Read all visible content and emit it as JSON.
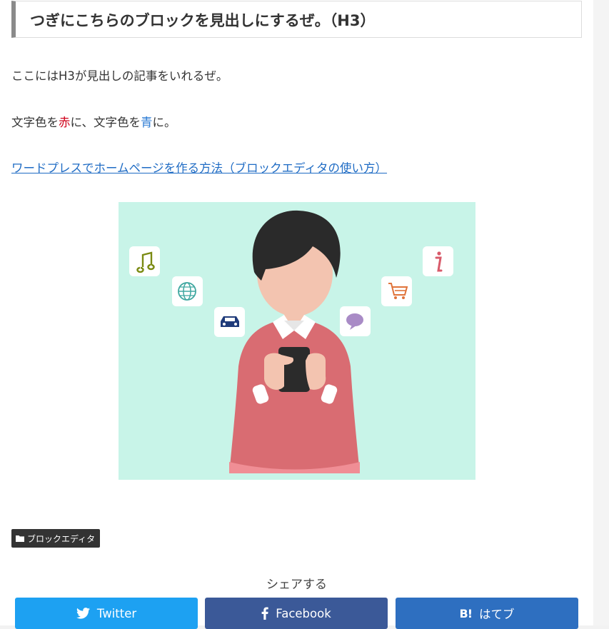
{
  "heading": "つぎにこちらのブロックを見出しにするぜ。（H3）",
  "paragraph1": "ここにはH3が見出しの記事をいれるぜ。",
  "paragraph2": {
    "part1": "文字色を",
    "red_word": "赤",
    "part2": "に、文字色を",
    "blue_word": "青",
    "part3": "に。"
  },
  "link_text": "ワードプレスでホームページを作る方法（ブロックエディタの使い方）",
  "category_tag": "ブロックエディタ",
  "share": {
    "title": "シェアする",
    "twitter": "Twitter",
    "facebook": "Facebook",
    "hatena_mark": "B!",
    "hatena": "はてブ"
  },
  "colors": {
    "red_text": "#d0021b",
    "blue_text": "#2b7bd4",
    "link": "#1e6bc4",
    "illustration_bg": "#c8f4e8",
    "twitter": "#1da1f2",
    "facebook": "#3b5998",
    "hatena": "#2e6fc0"
  },
  "illustration_icons": [
    "music-note-icon",
    "globe-icon",
    "car-icon",
    "chat-bubble-icon",
    "shopping-cart-icon",
    "info-icon"
  ]
}
